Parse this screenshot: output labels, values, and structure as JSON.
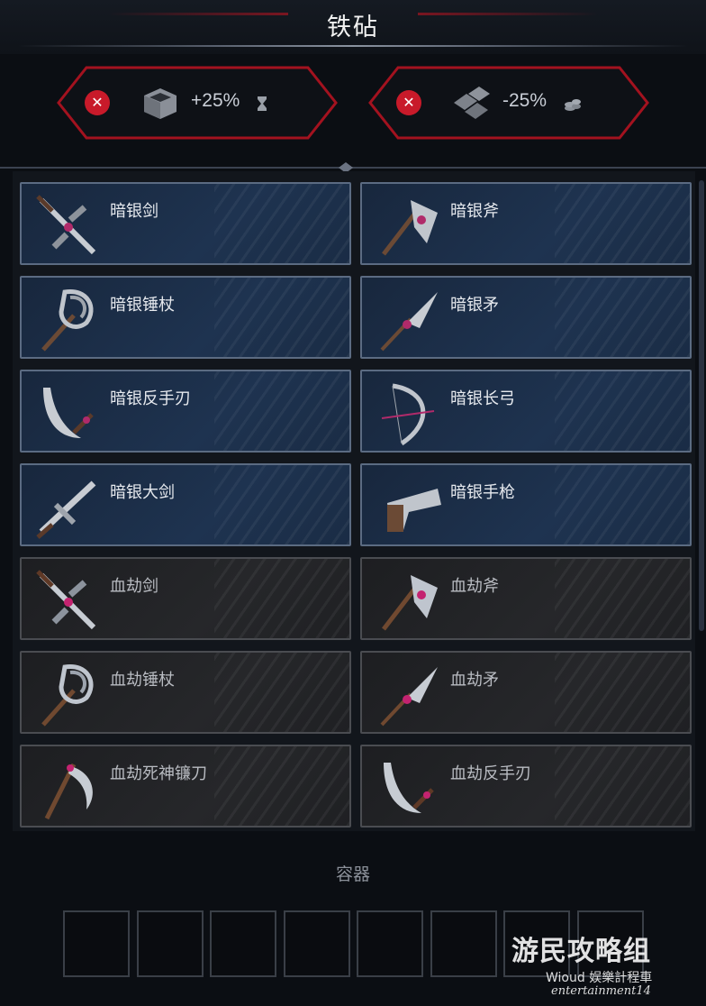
{
  "header": {
    "title": "铁砧"
  },
  "modifiers": [
    {
      "value": "+25%",
      "unit_icon": "hourglass-icon",
      "item_icon": "box-icon",
      "remove_icon": "close-icon"
    },
    {
      "value": "-25%",
      "unit_icon": "coins-icon",
      "item_icon": "plates-icon",
      "remove_icon": "close-icon"
    }
  ],
  "recipes": [
    {
      "name": "暗银剑",
      "tier": "silver",
      "icon": "sword-icon"
    },
    {
      "name": "暗银斧",
      "tier": "silver",
      "icon": "axe-icon"
    },
    {
      "name": "暗银锤杖",
      "tier": "silver",
      "icon": "mace-icon"
    },
    {
      "name": "暗银矛",
      "tier": "silver",
      "icon": "spear-icon"
    },
    {
      "name": "暗银反手刃",
      "tier": "silver",
      "icon": "reverse-blade-icon"
    },
    {
      "name": "暗银长弓",
      "tier": "silver",
      "icon": "longbow-icon"
    },
    {
      "name": "暗银大剑",
      "tier": "silver",
      "icon": "greatsword-icon"
    },
    {
      "name": "暗银手枪",
      "tier": "silver",
      "icon": "pistol-icon"
    },
    {
      "name": "血劫剑",
      "tier": "blood",
      "icon": "sword-icon"
    },
    {
      "name": "血劫斧",
      "tier": "blood",
      "icon": "axe-icon"
    },
    {
      "name": "血劫锤杖",
      "tier": "blood",
      "icon": "mace-icon"
    },
    {
      "name": "血劫矛",
      "tier": "blood",
      "icon": "spear-icon"
    },
    {
      "name": "血劫死神镰刀",
      "tier": "blood",
      "icon": "scythe-icon"
    },
    {
      "name": "血劫反手刃",
      "tier": "blood",
      "icon": "reverse-blade-icon"
    }
  ],
  "container": {
    "label": "容器",
    "slot_count": 8
  },
  "watermark": {
    "main": "游民攻略组",
    "sub1": "Wioud 娱樂計程車",
    "sub2": "entertainment14"
  },
  "colors": {
    "accent_red": "#c81a2a",
    "silver_card": "#1e3350",
    "blood_card": "#26272a"
  }
}
